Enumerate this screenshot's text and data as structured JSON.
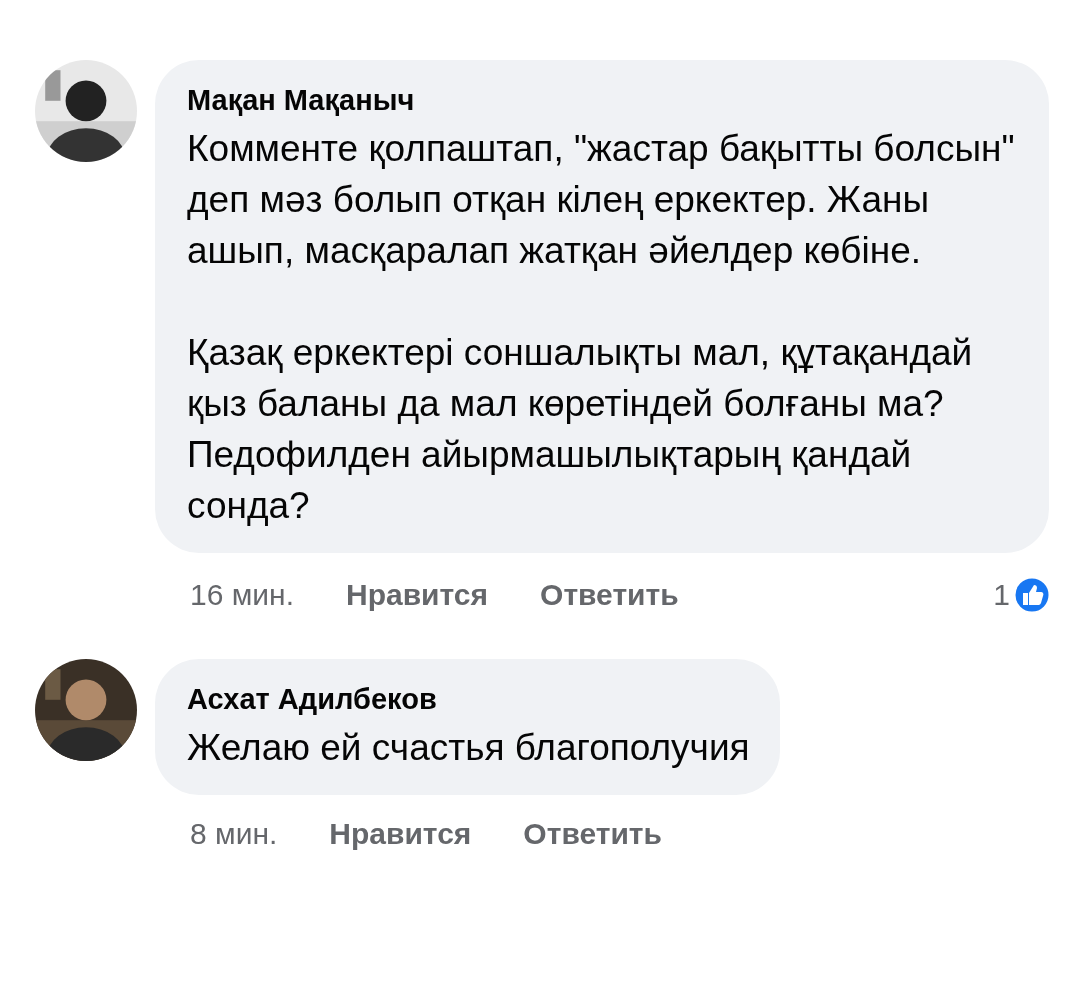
{
  "comments": [
    {
      "author": "Мақан Мақаныч",
      "avatar": {
        "kind": "picture"
      },
      "paragraphs": [
        "Комменте қолпаштап, \"жастар бақытты болсын\" деп мәз болып отқан кілең еркектер. Жаны ашып, масқаралап жатқан әйелдер көбіне.",
        "Қазақ еркектері соншалықты мал, құтақандай қыз баланы да мал көретіндей болғаны ма? Педофилден айырмашылықтарың қандай сонда?"
      ],
      "time": "16 мин.",
      "actions": [
        "Нравится",
        "Ответить"
      ],
      "reaction_count": "1"
    },
    {
      "author": "Асхат Адилбеков",
      "avatar": {
        "kind": "picture"
      },
      "paragraphs": [
        "Желаю ей счастья благополучия"
      ],
      "time": "8 мин.",
      "actions": [
        "Нравится",
        "Ответить"
      ]
    }
  ]
}
